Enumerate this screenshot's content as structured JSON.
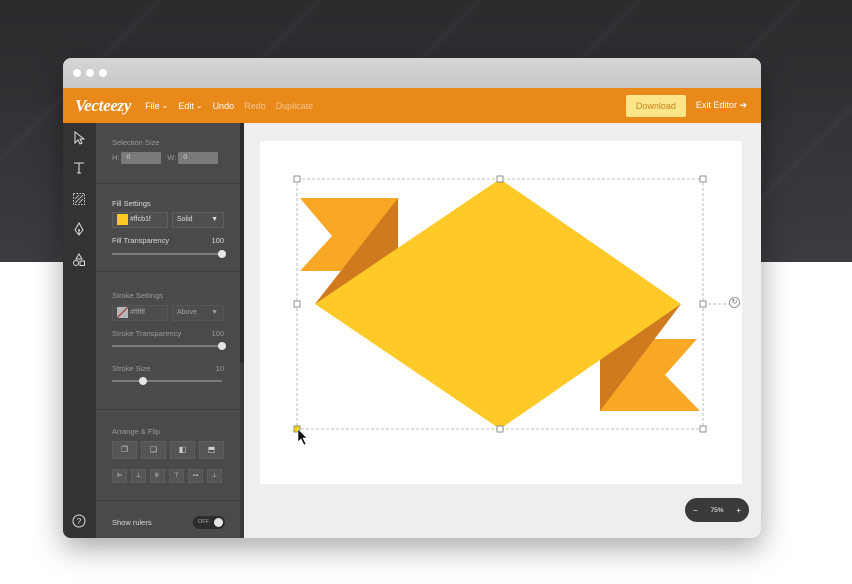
{
  "window": {
    "traffic_lights": 3
  },
  "toolbar": {
    "logo": "Vecteezy",
    "menu_file": "File",
    "menu_edit": "Edit",
    "undo": "Undo",
    "redo": "Redo",
    "duplicate": "Duplicate",
    "download": "Download",
    "exit_editor": "Exit Editor"
  },
  "panel": {
    "selection_size_label": "Selection Size",
    "h_label": "H:",
    "h_value": "0",
    "w_label": "W:",
    "w_value": "0",
    "fill_settings_label": "Fill Settings",
    "fill_color_hex": "#ffcb1f",
    "fill_type": "Solid",
    "fill_transparency_label": "Fill Transparency",
    "fill_transparency_value": "100",
    "fill_transparency_percent": 100,
    "stroke_settings_label": "Stroke Settings",
    "stroke_color_hex": "#ffffff",
    "stroke_position": "Above",
    "stroke_transparency_label": "Stroke Transparency",
    "stroke_transparency_value": "100",
    "stroke_transparency_percent": 100,
    "stroke_size_label": "Stroke Size",
    "stroke_size_value": "10",
    "stroke_size_percent": 28,
    "arrange_flip_label": "Arrange & Flip",
    "show_rulers_label": "Show rulers",
    "show_rulers_state": "OFF"
  },
  "zoom": {
    "minus": "−",
    "value": "75%",
    "plus": "+"
  },
  "colors": {
    "accent": "#e8891a",
    "download_bg": "#fde68a",
    "ribbon_main": "#ffc928",
    "ribbon_tail": "#f9a825",
    "ribbon_fold": "#cf7a1e"
  },
  "icons": {
    "tools": [
      "select-arrow-icon",
      "text-icon",
      "pattern-icon",
      "pen-icon",
      "shapes-icon"
    ],
    "help": "help-icon"
  }
}
